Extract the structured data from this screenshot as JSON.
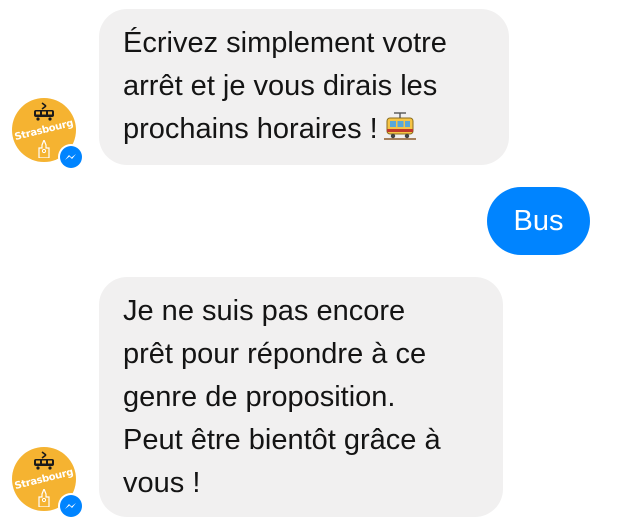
{
  "conversation": {
    "messages": [
      {
        "sender": "bot",
        "text": "Écrivez simplement votre\narrêt et je vous dirais les\nprochains horaires !",
        "emoji": "tram-emoji"
      },
      {
        "sender": "user",
        "text": "Bus"
      },
      {
        "sender": "bot",
        "text": "Je ne suis pas encore\nprêt pour répondre à ce\ngenre de proposition.\nPeut être bientôt grâce à\nvous !"
      }
    ]
  },
  "bot": {
    "avatar_text": "Strasbourg",
    "avatar_icon": "tram-icon",
    "badge_icon": "messenger-icon"
  },
  "colors": {
    "bot_bubble": "#f1f0f0",
    "user_bubble": "#0084ff",
    "avatar_bg": "#f5b331",
    "messenger_blue": "#0084ff"
  }
}
